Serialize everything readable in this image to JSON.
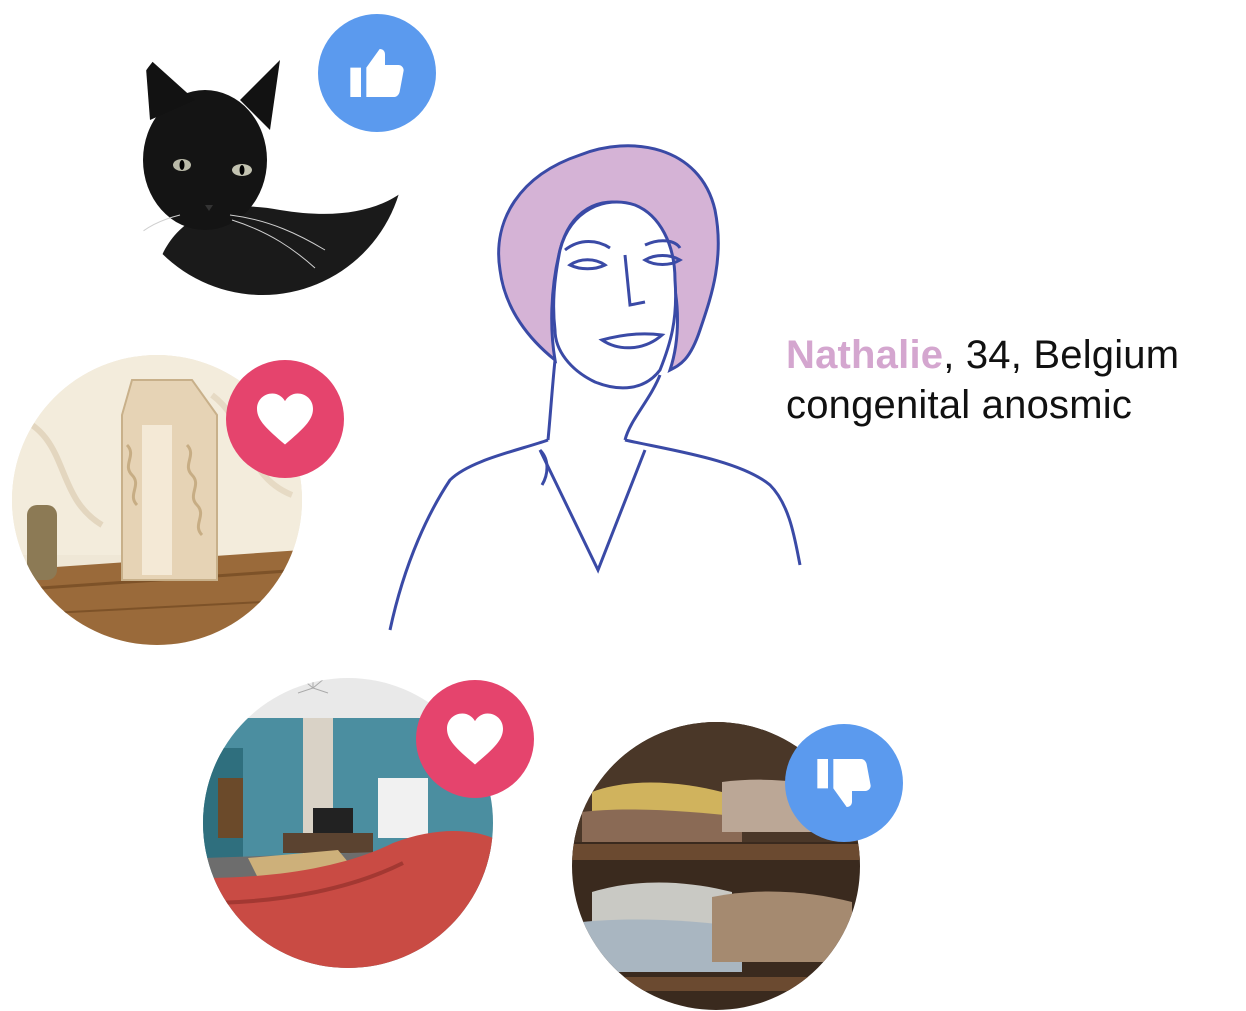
{
  "person": {
    "name": "Nathalie",
    "details": ", 34, Belgium",
    "condition": "congenital anosmic"
  },
  "reactions": [
    {
      "subject": "cat",
      "reaction": "like",
      "icon": "thumbs-up-icon"
    },
    {
      "subject": "vase",
      "reaction": "love",
      "icon": "heart-icon"
    },
    {
      "subject": "living room",
      "reaction": "love",
      "icon": "heart-icon"
    },
    {
      "subject": "clothes shelf",
      "reaction": "dislike",
      "icon": "thumbs-down-icon"
    }
  ],
  "colors": {
    "name_accent": "#d4a6cf",
    "hair": "#d5b3d6",
    "line": "#3a4aa6",
    "like_blue": "#5b9aee",
    "love_red": "#e5446d"
  }
}
